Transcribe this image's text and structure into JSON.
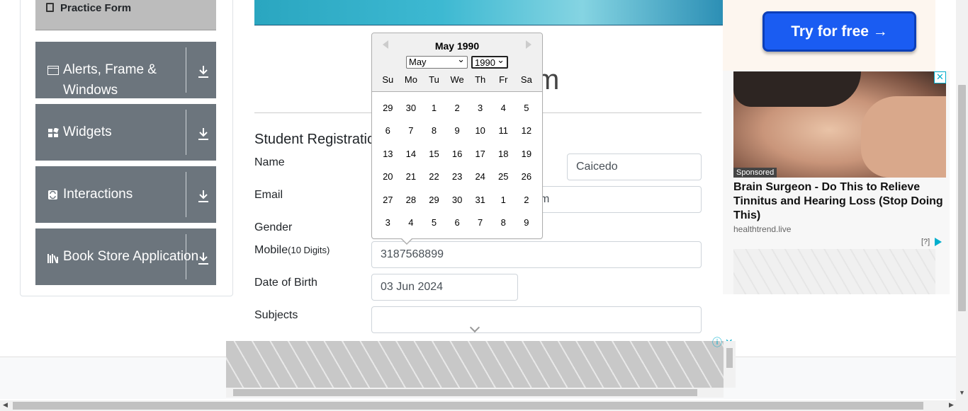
{
  "sidebar": {
    "practice_form": "Practice Form",
    "groups": [
      {
        "label": "Alerts, Frame & Windows",
        "icon": "window-icon"
      },
      {
        "label": "Widgets",
        "icon": "widgets-icon"
      },
      {
        "label": "Interactions",
        "icon": "interactions-icon"
      },
      {
        "label": "Book Store Application",
        "icon": "books-icon"
      }
    ]
  },
  "page": {
    "heading_tail": "m",
    "form_title": "Student Registratic"
  },
  "form": {
    "name_label": "Name",
    "last_name_value": "Caicedo",
    "email_label": "Email",
    "email_value_tail": "m",
    "gender_label": "Gender",
    "mobile_label": "Mobile",
    "mobile_hint": "(10 Digits)",
    "mobile_value": "3187568899",
    "dob_label": "Date of Birth",
    "dob_value": "03 Jun 2024",
    "subjects_label": "Subjects",
    "subjects_value": ""
  },
  "datepicker": {
    "title": "May 1990",
    "month_select": "May",
    "year_select": "1990",
    "weekdays": [
      "Su",
      "Mo",
      "Tu",
      "We",
      "Th",
      "Fr",
      "Sa"
    ],
    "weeks": [
      [
        "29",
        "30",
        "1",
        "2",
        "3",
        "4",
        "5"
      ],
      [
        "6",
        "7",
        "8",
        "9",
        "10",
        "11",
        "12"
      ],
      [
        "13",
        "14",
        "15",
        "16",
        "17",
        "18",
        "19"
      ],
      [
        "20",
        "21",
        "22",
        "23",
        "24",
        "25",
        "26"
      ],
      [
        "27",
        "28",
        "29",
        "30",
        "31",
        "1",
        "2"
      ],
      [
        "3",
        "4",
        "5",
        "6",
        "7",
        "8",
        "9"
      ]
    ]
  },
  "ads": {
    "try_button": "Try for free →",
    "sponsored": "Sponsored",
    "title": "Brain Surgeon - Do This to Relieve Tinnitus and Hearing Loss (Stop Doing This)",
    "source": "healthtrend.live",
    "info": "[?]",
    "close": "✕",
    "bottom_icons": "ⓘ ✕"
  },
  "colors": {
    "sidebar_group": "#6c757d",
    "practice_active": "#bcbcbc",
    "ad_button": "#1a5cf2"
  }
}
